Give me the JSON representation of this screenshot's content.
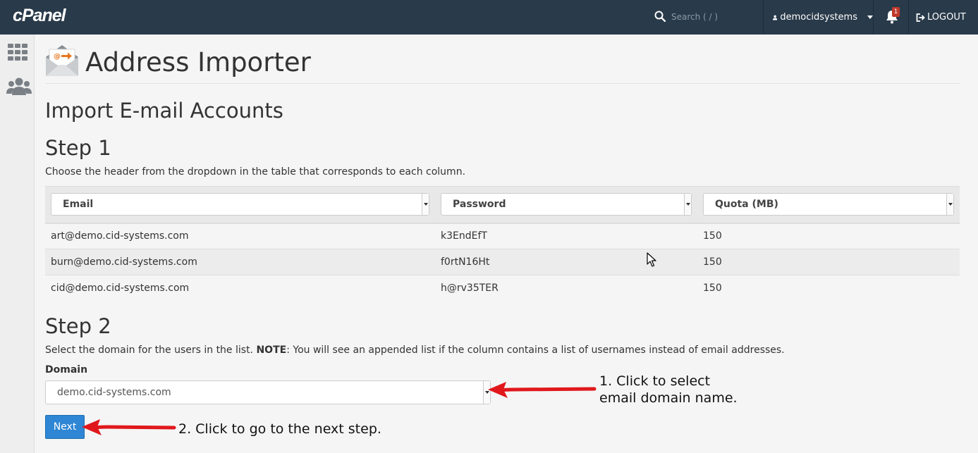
{
  "topbar": {
    "logo": "cPanel",
    "search_placeholder": "Search ( / )",
    "username": "democidsystems",
    "notification_count": "1",
    "logout_label": "LOGOUT"
  },
  "sidebar": {
    "items": [
      {
        "icon": "apps-grid-icon"
      },
      {
        "icon": "users-icon"
      }
    ]
  },
  "page": {
    "title": "Address Importer",
    "subtitle": "Import E-mail Accounts"
  },
  "step1": {
    "heading": "Step 1",
    "description": "Choose the header from the dropdown in the table that corresponds to each column.",
    "columns": [
      "Email",
      "Password",
      "Quota (MB)"
    ],
    "rows": [
      [
        "art@demo.cid-systems.com",
        "k3EndEfT",
        "150"
      ],
      [
        "burn@demo.cid-systems.com",
        "f0rtN16Ht",
        "150"
      ],
      [
        "cid@demo.cid-systems.com",
        "h@rv35TER",
        "150"
      ]
    ]
  },
  "step2": {
    "heading": "Step 2",
    "description_pre": "Select the domain for the users in the list. ",
    "description_note": "NOTE",
    "description_post": ": You will see an appended list if the column contains a list of usernames instead of email addresses.",
    "domain_label": "Domain",
    "domain_value": "demo.cid-systems.com",
    "next_label": "Next"
  },
  "annotations": {
    "note1_line1": "1. Click to select",
    "note1_line2": "email domain name.",
    "note2": "2. Click to go to the next step.",
    "arrow_color": "#e0181c"
  }
}
